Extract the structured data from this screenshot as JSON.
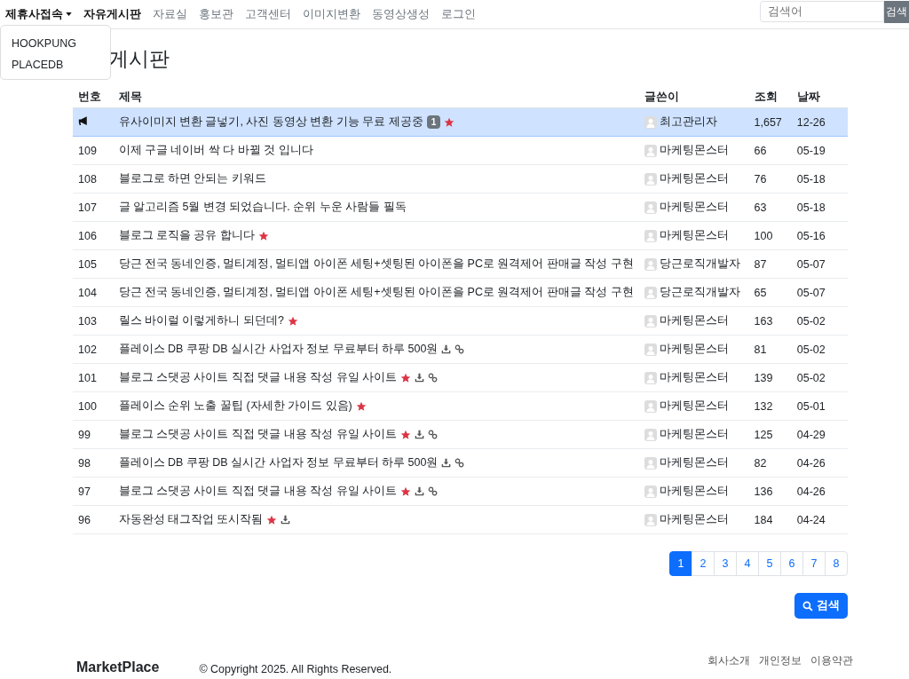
{
  "nav": {
    "items": [
      {
        "label": "제휴사접속",
        "kind": "dropdown",
        "expanded": true
      },
      {
        "label": "자유게시판",
        "kind": "link",
        "selected": true
      },
      {
        "label": "자료실",
        "kind": "link",
        "selected": false
      },
      {
        "label": "홍보관",
        "kind": "link",
        "selected": false
      },
      {
        "label": "고객센터",
        "kind": "link",
        "selected": false
      },
      {
        "label": "이미지변환",
        "kind": "link",
        "selected": false
      },
      {
        "label": "동영상생성",
        "kind": "link",
        "selected": false
      },
      {
        "label": "로그인",
        "kind": "link",
        "selected": false
      }
    ],
    "dropdown_items": [
      "HOOKPUNG",
      "PLACEDB"
    ],
    "search": {
      "placeholder": "검색어",
      "button": "검색"
    }
  },
  "page_title": "게시판",
  "table": {
    "columns": [
      "번호",
      "제목",
      "글쓴이",
      "조회",
      "날짜"
    ],
    "rows": [
      {
        "kind": "notice",
        "number": "",
        "title": "유사이미지 변환 글넣기, 사진 동영상 변환 기능 무료 제공중",
        "comments": "1",
        "hot": true,
        "file": false,
        "link": false,
        "author": "최고관리자",
        "views": "1,657",
        "date": "12-26"
      },
      {
        "kind": "post",
        "number": "109",
        "title": "이제 구글 네이버 싹 다 바뀔 것 입니다",
        "hot": false,
        "file": false,
        "link": false,
        "author": "마케팅몬스터",
        "views": "66",
        "date": "05-19"
      },
      {
        "kind": "post",
        "number": "108",
        "title": "블로그로 하면 안되는 키워드",
        "hot": false,
        "file": false,
        "link": false,
        "author": "마케팅몬스터",
        "views": "76",
        "date": "05-18"
      },
      {
        "kind": "post",
        "number": "107",
        "title": "글 알고리즘 5월 변경 되었습니다. 순위 누운 사람들 필독",
        "hot": false,
        "file": false,
        "link": false,
        "author": "마케팅몬스터",
        "views": "63",
        "date": "05-18"
      },
      {
        "kind": "post",
        "number": "106",
        "title": "블로그 로직을 공유 합니다",
        "hot": true,
        "file": false,
        "link": false,
        "author": "마케팅몬스터",
        "views": "100",
        "date": "05-16"
      },
      {
        "kind": "post",
        "number": "105",
        "title": "당근 전국 동네인증, 멀티계정, 멀티앱 아이폰 세팅+셋팅된 아이폰을 PC로 원격제어 판매글 작성 구현",
        "hot": false,
        "file": false,
        "link": false,
        "author": "당근로직개발자",
        "views": "87",
        "date": "05-07"
      },
      {
        "kind": "post",
        "number": "104",
        "title": "당근 전국 동네인증, 멀티계정, 멀티앱 아이폰 세팅+셋팅된 아이폰을 PC로 원격제어 판매글 작성 구현",
        "hot": false,
        "file": false,
        "link": false,
        "author": "당근로직개발자",
        "views": "65",
        "date": "05-07"
      },
      {
        "kind": "post",
        "number": "103",
        "title": "릴스 바이럴 이렇게하니 되던데?",
        "hot": true,
        "file": false,
        "link": false,
        "author": "마케팅몬스터",
        "views": "163",
        "date": "05-02"
      },
      {
        "kind": "post",
        "number": "102",
        "title": "플레이스 DB 쿠팡 DB 실시간 사업자 정보 무료부터 하루 500원",
        "hot": false,
        "file": true,
        "link": true,
        "author": "마케팅몬스터",
        "views": "81",
        "date": "05-02"
      },
      {
        "kind": "post",
        "number": "101",
        "title": "블로그 스댓공 사이트 직접 댓글 내용 작성 유일 사이트",
        "hot": true,
        "file": true,
        "link": true,
        "author": "마케팅몬스터",
        "views": "139",
        "date": "05-02"
      },
      {
        "kind": "post",
        "number": "100",
        "title": "플레이스 순위 노출 꿀팁 (자세한 가이드 있음)",
        "hot": true,
        "file": false,
        "link": false,
        "author": "마케팅몬스터",
        "views": "132",
        "date": "05-01"
      },
      {
        "kind": "post",
        "number": "99",
        "title": "블로그 스댓공 사이트 직접 댓글 내용 작성 유일 사이트",
        "hot": true,
        "file": true,
        "link": true,
        "author": "마케팅몬스터",
        "views": "125",
        "date": "04-29"
      },
      {
        "kind": "post",
        "number": "98",
        "title": "플레이스 DB 쿠팡 DB 실시간 사업자 정보 무료부터 하루 500원",
        "hot": false,
        "file": true,
        "link": true,
        "author": "마케팅몬스터",
        "views": "82",
        "date": "04-26"
      },
      {
        "kind": "post",
        "number": "97",
        "title": "블로그 스댓공 사이트 직접 댓글 내용 작성 유일 사이트",
        "hot": true,
        "file": true,
        "link": true,
        "author": "마케팅몬스터",
        "views": "136",
        "date": "04-26"
      },
      {
        "kind": "post",
        "number": "96",
        "title": "자동완성 태그작업 또시작됨",
        "hot": true,
        "file": true,
        "link": false,
        "author": "마케팅몬스터",
        "views": "184",
        "date": "04-24"
      }
    ]
  },
  "pagination": [
    {
      "label": "1",
      "selected": true
    },
    {
      "label": "2",
      "selected": false
    },
    {
      "label": "3",
      "selected": false
    },
    {
      "label": "4",
      "selected": false
    },
    {
      "label": "5",
      "selected": false
    },
    {
      "label": "6",
      "selected": false
    },
    {
      "label": "7",
      "selected": false
    },
    {
      "label": "8",
      "selected": false
    }
  ],
  "search_button": "검색",
  "footer": {
    "logo": "MarketPlace",
    "copyright": "© Copyright 2025. All Rights Reserved.",
    "links": [
      "회사소개",
      "개인정보",
      "이용약관"
    ]
  }
}
